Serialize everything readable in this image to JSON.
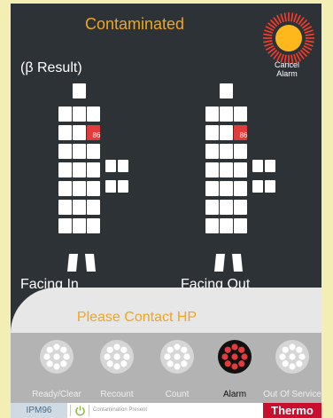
{
  "header": {
    "status_title": "Contaminated",
    "result_label": "(β Result)",
    "cancel_alarm": [
      "Cancel",
      "Alarm"
    ]
  },
  "detectors": {
    "facing_in_label": "Facing In",
    "facing_out_label": "Facing Out",
    "facing_in_reading": "86",
    "facing_out_reading": "86",
    "alarm_color": "#e23b3b"
  },
  "contact_message": "Please Contact HP",
  "mode_buttons": [
    {
      "label": "Ready/Clear",
      "icon": "detector-ring-icon",
      "active": false
    },
    {
      "label": "Recount",
      "icon": "detector-ring-icon",
      "active": false
    },
    {
      "label": "Count",
      "icon": "detector-ring-icon",
      "active": false
    },
    {
      "label": "Alarm",
      "icon": "detector-ring-icon",
      "active": true
    },
    {
      "label": "Out Of Service",
      "icon": "detector-ring-icon",
      "active": false
    }
  ],
  "footer": {
    "device_id": "IPM96",
    "status_message": "Contamination Present",
    "brand": "Thermo"
  },
  "colors": {
    "accent": "#f2a51c",
    "alarm": "#e23b3b",
    "brand": "#c8102e"
  }
}
